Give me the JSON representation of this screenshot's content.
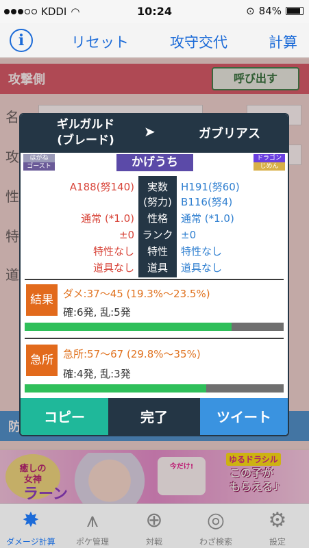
{
  "status": {
    "carrier": "KDDI",
    "time": "10:24",
    "battery": "84%"
  },
  "nav": {
    "info": "i",
    "reset": "リセット",
    "swap": "攻守交代",
    "calc": "計算"
  },
  "attacker_panel": {
    "title": "攻撃側",
    "call_button": "呼び出す",
    "labels": [
      "名",
      "攻",
      "性",
      "特",
      "道"
    ]
  },
  "defender_panel": {
    "title": "防"
  },
  "modal": {
    "attacker": "ギルガルド(ブレード)",
    "attacker_line1": "ギルガルド",
    "attacker_line2": "(ブレード)",
    "arrow": "➤",
    "defender": "ガブリアス",
    "attacker_types": [
      "はがね",
      "ゴースト"
    ],
    "defender_types": [
      "ドラゴン",
      "じめん"
    ],
    "move": "かげうち",
    "stats": {
      "attacker": [
        "A188(努140)",
        "通常 (*1.0)",
        "±0",
        "特性なし",
        "道具なし"
      ],
      "labels": [
        "実数",
        "(努力)",
        "性格",
        "ランク",
        "特性",
        "道具"
      ],
      "defender": [
        "H191(努60)",
        "B116(努4)",
        "通常 (*1.0)",
        "±0",
        "特性なし",
        "道具なし"
      ]
    },
    "result": {
      "label": "結果",
      "damage": "ダメ:37〜45 (19.3%〜23.5%)",
      "ko": "確:6発, 乱:5発",
      "bar_percent": 80
    },
    "critical": {
      "label": "急所",
      "damage": "急所:57〜67 (29.8%〜35%)",
      "ko": "確:4発, 乱:3発",
      "bar_percent": 70
    },
    "buttons": {
      "copy": "コピー",
      "done": "完了",
      "tweet": "ツイート"
    }
  },
  "ad": {
    "title1": "癒しの",
    "title2": "女神",
    "title3": "ラーン",
    "badge": "今だけ!",
    "brand": "ゆるドラシル",
    "promo1": "この子が",
    "promo2": "もらえる♪"
  },
  "tabs": [
    "ダメージ計算",
    "ポケ管理",
    "対戦",
    "わざ検索",
    "設定"
  ],
  "colors": {
    "accent": "#1c6bd8",
    "modal_dark": "#243645",
    "attack_red": "#d8453a",
    "defend_blue": "#2f7fd0",
    "result_orange": "#e26a1c",
    "bar_green": "#2fbf5a"
  }
}
